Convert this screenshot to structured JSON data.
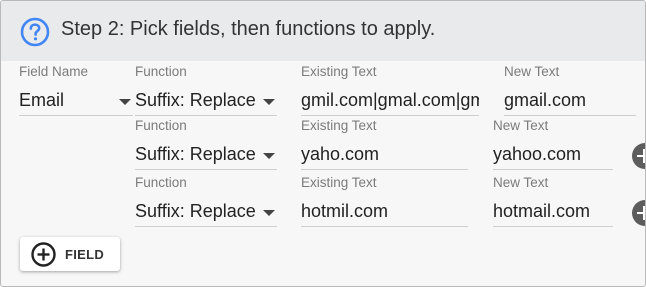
{
  "header": {
    "title": "Step 2: Pick fields, then functions to apply."
  },
  "labels": {
    "field_name": "Field Name",
    "function": "Function",
    "existing_text": "Existing Text",
    "new_text": "New Text"
  },
  "field": {
    "selected": "Email"
  },
  "rows": [
    {
      "function": "Suffix: Replace",
      "existing_text": "gmil.com|gmal.com|gmail.co",
      "new_text": "gmail.com"
    },
    {
      "function": "Suffix: Replace",
      "existing_text": "yaho.com",
      "new_text": "yahoo.com"
    },
    {
      "function": "Suffix: Replace",
      "existing_text": "hotmil.com",
      "new_text": "hotmail.com"
    }
  ],
  "add_field_button": {
    "label": "FIELD"
  },
  "icons": {
    "help": "help-circle-icon",
    "add_row": "add-circle-icon",
    "add_field": "add-circle-outline-icon"
  },
  "colors": {
    "accent": "#4285f4",
    "header_bg": "#e9eaec",
    "body_bg": "#f7f7f7"
  }
}
